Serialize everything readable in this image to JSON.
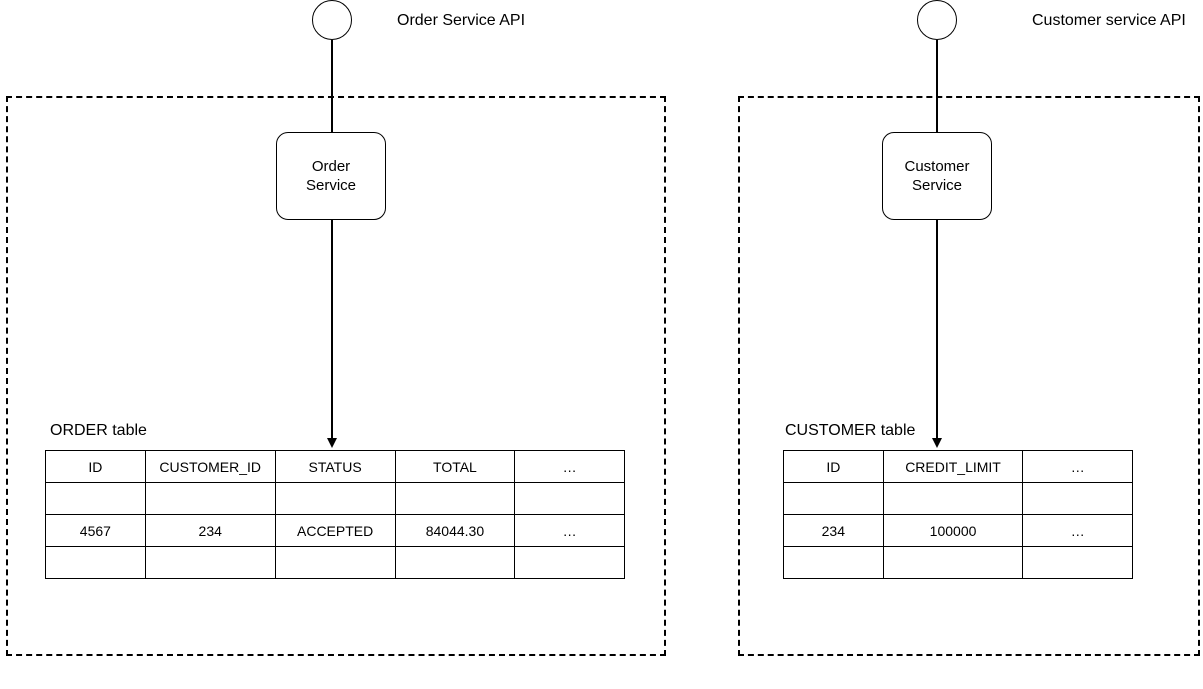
{
  "left": {
    "api_label": "Order Service API",
    "service_label": "Order\nService",
    "table_label": "ORDER table",
    "table": {
      "headers": [
        "ID",
        "CUSTOMER_ID",
        "STATUS",
        "TOTAL",
        "…"
      ],
      "row_empty_top": [
        "",
        "",
        "",
        "",
        ""
      ],
      "row_data": [
        "4567",
        "234",
        "ACCEPTED",
        "84044.30",
        "…"
      ],
      "row_empty_bottom": [
        "",
        "",
        "",
        "",
        ""
      ]
    }
  },
  "right": {
    "api_label": "Customer service API",
    "service_label": "Customer\nService",
    "table_label": "CUSTOMER table",
    "table": {
      "headers": [
        "ID",
        "CREDIT_LIMIT",
        "…"
      ],
      "row_empty_top": [
        "",
        "",
        ""
      ],
      "row_data": [
        "234",
        "100000",
        "…"
      ],
      "row_empty_bottom": [
        "",
        "",
        ""
      ]
    }
  }
}
